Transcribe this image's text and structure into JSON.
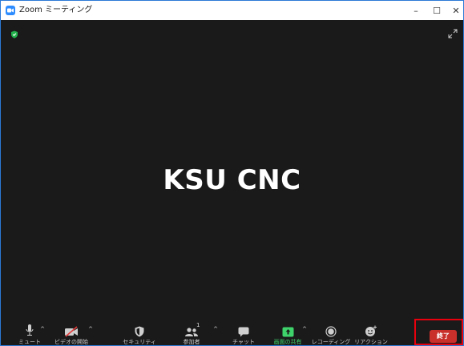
{
  "window": {
    "title": "Zoom ミーティング",
    "minimize_glyph": "–",
    "maximize_glyph": "☐",
    "close_glyph": "✕"
  },
  "meeting": {
    "participant_name": "KSU CNC"
  },
  "toolbar": {
    "mute_label": "ミュート",
    "video_label": "ビデオの開始",
    "security_label": "セキュリティ",
    "participants_label": "参加者",
    "participants_count": "1",
    "chat_label": "チャット",
    "share_label": "画面の共有",
    "record_label": "レコーディング",
    "reaction_label": "リアクション",
    "end_label": "終了"
  },
  "colors": {
    "window_border": "#2b79d6",
    "video_bg": "#1a1a1a",
    "share_green": "#3ed36b",
    "end_red": "#c9302c",
    "highlight_red": "#e8000d",
    "security_green": "#22b14c"
  },
  "icons": [
    "zoom-app-icon",
    "shield-check-icon",
    "fullscreen-icon",
    "microphone-icon",
    "video-off-icon",
    "security-shield-icon",
    "participants-icon",
    "chat-bubble-icon",
    "share-screen-icon",
    "record-icon",
    "reaction-icon",
    "caret-up-icon"
  ]
}
